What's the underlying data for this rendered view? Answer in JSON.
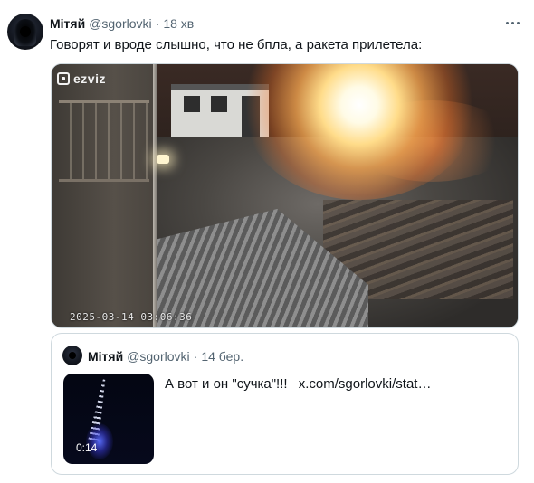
{
  "tweet": {
    "author_name": "Мітяй",
    "author_handle": "@sgorlovki",
    "separator": "·",
    "timestamp": "18 хв",
    "text": "Говорят и вроде слышно, что не бпла, а ракета прилетела:",
    "video": {
      "watermark": "ezviz",
      "camera_timestamp": "2025-03-14 03:06:36"
    },
    "more_icon": "more-horizontal-icon"
  },
  "quoted_tweet": {
    "author_name": "Мітяй",
    "author_handle": "@sgorlovki",
    "separator": "·",
    "timestamp": "14 бер.",
    "text": "А вот и он \"сучка\"!!!",
    "link": "x.com/sgorlovki/stat…",
    "media_duration": "0:14"
  }
}
